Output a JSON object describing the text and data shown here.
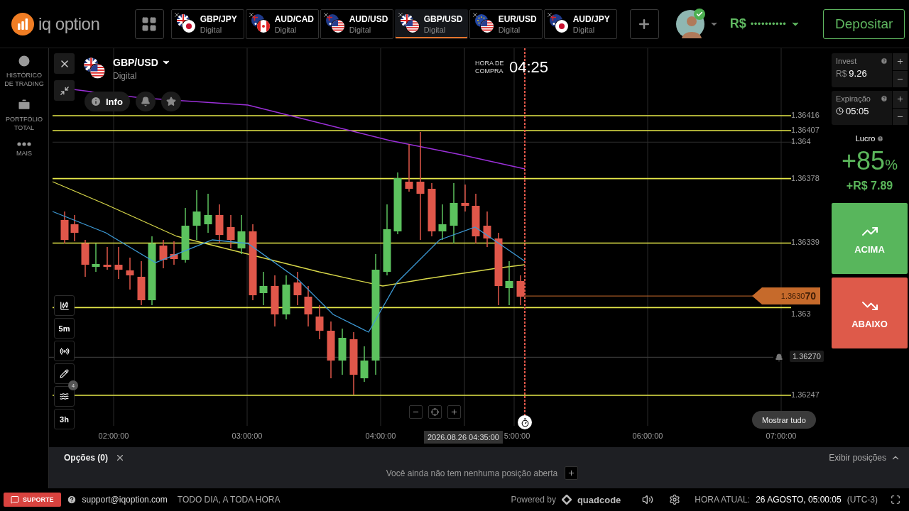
{
  "top_bar": {
    "logo_text": "iq option",
    "asset_tabs": [
      {
        "name": "GBP/JPY",
        "type": "Digital",
        "selected": false
      },
      {
        "name": "AUD/CAD",
        "type": "Digital",
        "selected": false
      },
      {
        "name": "AUD/USD",
        "type": "Digital",
        "selected": false
      },
      {
        "name": "GBP/USD",
        "type": "Digital",
        "selected": true
      },
      {
        "name": "EUR/USD",
        "type": "Digital",
        "selected": false
      },
      {
        "name": "AUD/JPY",
        "type": "Digital",
        "selected": false
      }
    ],
    "balance_currency": "R$",
    "balance_hidden": "••••••••••",
    "deposit_button": "Depositar"
  },
  "sidebar": {
    "items": [
      {
        "label": "HISTÓRICO DE TRADING"
      },
      {
        "label": "PORTFÓLIO TOTAL"
      },
      {
        "label": "MAIS"
      }
    ]
  },
  "chart": {
    "asset": "GBP/USD",
    "asset_type": "Digital",
    "info_button": "Info",
    "purchase_time_label": "HORA DE COMPRA",
    "purchase_time": "04:25",
    "price_levels": [
      {
        "price": "1.36416",
        "kind": "level"
      },
      {
        "price": "1.36407",
        "kind": "level"
      },
      {
        "price": "1.364",
        "kind": "tick"
      },
      {
        "price": "1.36378",
        "kind": "level"
      },
      {
        "price": "1.36339",
        "kind": "level"
      },
      {
        "price": "1.363",
        "kind": "level"
      },
      {
        "price": "1.36270",
        "kind": "alert"
      },
      {
        "price": "1.36247",
        "kind": "level"
      }
    ],
    "current_price": "1.3630**70**",
    "time_labels": [
      "02:00:00",
      "03:00:00",
      "04:00:00",
      "5:00:00",
      "06:00:00",
      "07:00:00"
    ],
    "date_tooltip": "2026.08.26 04:35:00",
    "timeframe_button": "5m",
    "period_button": "3h",
    "indicator_count": "4",
    "show_all_button": "Mostrar tudo"
  },
  "trade_panel": {
    "invest_label": "Invest",
    "invest_currency": "R$",
    "invest_value": "9.26",
    "expiry_label": "Expiração",
    "expiry_value": "05:05",
    "profit_label": "Lucro",
    "profit_percent": "+85",
    "profit_unit": "%",
    "profit_amount": "+R$ 7.89",
    "up_button": "ACIMA",
    "down_button": "ABAIXO"
  },
  "positions_panel": {
    "title": "Opções (0)",
    "toggle": "Exibir posições",
    "empty_message": "Você ainda não tem nenhuma posição aberta"
  },
  "footer": {
    "support_button": "SUPORTE",
    "email": "support@iqoption.com",
    "hours": "TODO DIA, A TODA HORA",
    "powered_by": "Powered by",
    "brand": "quadcode",
    "clock_label": "HORA ATUAL:",
    "clock_value": "26 AGOSTO, 05:00:05",
    "timezone": "(UTC-3)"
  }
}
